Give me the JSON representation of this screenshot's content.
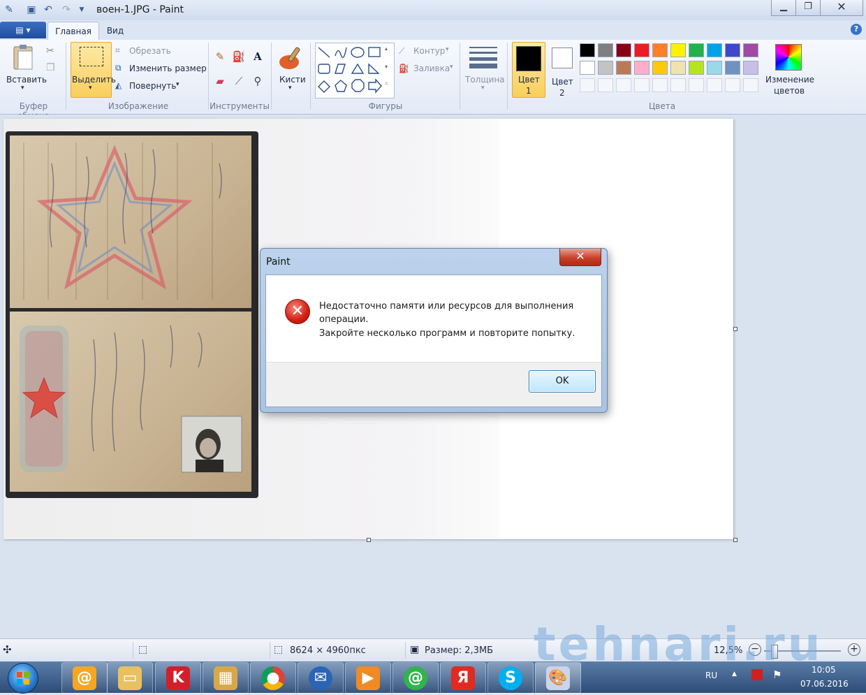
{
  "window": {
    "title": "воен-1.JPG - Paint",
    "qat_icons": [
      "paint-app-icon",
      "save-icon",
      "undo-icon",
      "redo-icon",
      "dropdown-icon"
    ]
  },
  "tabs": {
    "file": "",
    "home": "Главная",
    "view": "Вид"
  },
  "ribbon": {
    "clipboard": {
      "paste": "Вставить",
      "group": "Буфер обмена"
    },
    "image": {
      "select": "Выделить",
      "crop": "Обрезать",
      "resize": "Изменить размер",
      "rotate": "Повернуть",
      "group": "Изображение"
    },
    "tools": {
      "group": "Инструменты"
    },
    "brushes": {
      "label": "Кисти"
    },
    "shapes": {
      "outline": "Контур",
      "fill": "Заливка",
      "group": "Фигуры"
    },
    "size": {
      "label": "Толщина"
    },
    "colors": {
      "color1": "Цвет",
      "color1_num": "1",
      "color2": "Цвет",
      "color2_num": "2",
      "edit_line1": "Изменение",
      "edit_line2": "цветов",
      "group": "Цвета",
      "row1": [
        "#000000",
        "#7f7f7f",
        "#880015",
        "#ed1c24",
        "#ff7f27",
        "#fff200",
        "#22b14c",
        "#00a2e8",
        "#3f48cc",
        "#a349a4"
      ],
      "row2": [
        "#ffffff",
        "#c3c3c3",
        "#b97a57",
        "#ffaec9",
        "#ffc90e",
        "#efe4b0",
        "#b5e61d",
        "#99d9ea",
        "#7092be",
        "#c8bfe7"
      ]
    }
  },
  "dialog": {
    "title": "Paint",
    "line1": "Недостаточно памяти или ресурсов для выполнения",
    "line2": "операции.",
    "line3": "Закройте несколько программ и повторите попытку.",
    "ok": "OK"
  },
  "status": {
    "dimensions": "8624 × 4960пкс",
    "size": "Размер: 2,3МБ",
    "zoom": "12,5%"
  },
  "watermark": "tehnari.ru",
  "taskbar": {
    "lang": "RU",
    "time": "10:05",
    "date": "07.06.2016"
  }
}
